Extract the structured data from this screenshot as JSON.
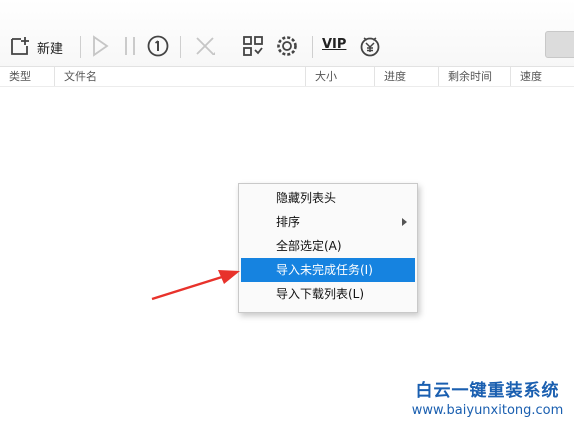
{
  "toolbar": {
    "new_label": "新建",
    "vip_label": "VIP"
  },
  "icons": {
    "new": "new-task-icon",
    "start": "play-icon",
    "pause": "pause-icon",
    "limit": "speed-limit-icon",
    "delete": "delete-icon",
    "qr": "qr-code-icon",
    "settings": "settings-icon",
    "vip": "vip-icon",
    "money": "yen-icon"
  },
  "columns": [
    "类型",
    "文件名",
    "大小",
    "进度",
    "剩余时间",
    "速度"
  ],
  "context_menu": {
    "items": [
      {
        "label": "隐藏列表头",
        "submenu": false,
        "active": false
      },
      {
        "label": "排序",
        "submenu": true,
        "active": false
      },
      {
        "label": "全部选定(A)",
        "submenu": false,
        "active": false
      },
      {
        "label": "导入未完成任务(I)",
        "submenu": false,
        "active": true
      },
      {
        "label": "导入下载列表(L)",
        "submenu": false,
        "active": false
      }
    ]
  },
  "watermark": {
    "title": "白云一键重装系统",
    "url": "www.baiyunxitong.com"
  },
  "colors": {
    "highlight": "#1683e0",
    "arrow": "#e8322b",
    "watermark": "#1a5fb0"
  }
}
